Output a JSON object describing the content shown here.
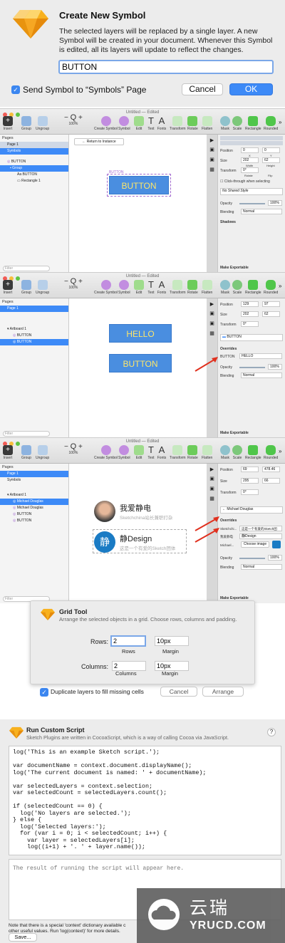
{
  "dialog1": {
    "title": "Create New Symbol",
    "description": "The selected layers will be replaced by a single layer. A new Symbol will be created in your document. Whenever this Symbol is edited, all its layers will update to reflect the changes.",
    "name_value": "BUTTON",
    "checkbox_label": "Send Symbol to “Symbols” Page",
    "cancel": "Cancel",
    "ok": "OK"
  },
  "toolbar": {
    "insert": "Insert",
    "group": "Group",
    "ungroup": "Ungroup",
    "zoom": "100%",
    "create_symbol": "Create Symbol",
    "symbol": "Symbol",
    "edit": "Edit",
    "text": "Text",
    "fonts": "Fonts",
    "transform": "Transform",
    "rotate": "Rotate",
    "flatten": "Flatten",
    "mask": "Mask",
    "scale": "Scale",
    "rectangle": "Rectangle",
    "rounded": "Rounded",
    "minus": "−",
    "plus": "+",
    "more": "»"
  },
  "win1": {
    "title": "Untitled — Edited",
    "pages_header": "Pages",
    "pages": [
      "Page 1",
      "Symbols"
    ],
    "layers": [
      "BUTTON",
      "Group",
      "BUTTON",
      "Rectangle 1"
    ],
    "return_btn": "Return to Instance",
    "artboard_label": "BUTTON",
    "button_text": "BUTTON",
    "position_label": "Position",
    "pos_x": "0",
    "pos_y": "0",
    "x": "X",
    "y": "Y",
    "size_label": "Size",
    "w": "202",
    "h": "62",
    "width": "Width",
    "height": "Height",
    "transform_label": "Transform",
    "rot": "0°",
    "rotate_label": "Rotate",
    "flip_label": "Flip",
    "click_through": "Click-through when selecting",
    "shared_style": "No Shared Style",
    "opacity_label": "Opacity",
    "opacity": "100%",
    "blending_label": "Blending",
    "blending": "Normal",
    "shadows": "Shadows",
    "make_exportable": "Make Exportable",
    "filter": "Filter"
  },
  "win2": {
    "title": "Untitled — Edited",
    "pages_header": "Pages",
    "pages": [
      "Page 1"
    ],
    "layers": [
      "Artboard 1",
      "BUTTON",
      "BUTTON"
    ],
    "hello": "HELLO",
    "button": "BUTTON",
    "pos_x": "129",
    "pos_y": "97",
    "w": "202",
    "h": "62",
    "rot": "0°",
    "symbol": "BUTTON",
    "overrides": "Overrides",
    "override_key": "BUTTON",
    "override_val": "HELLO",
    "opacity": "100%",
    "blending": "Normal",
    "make_exportable": "Make Exportable",
    "filter": "Filter"
  },
  "win3": {
    "title": "Untitled — Edited",
    "pages_header": "Pages",
    "pages": [
      "Page 1",
      "Symbols"
    ],
    "layers": [
      "Artboard 1",
      "Michael Douglas",
      "Michael Douglas",
      "BUTTON",
      "BUTTON"
    ],
    "card1_name": "我爱静电",
    "card1_sub": "Sketchchina站长兼职打杂",
    "card2_name": "静Design",
    "card2_sub": "这是一个有爱的Sketch团体",
    "logo_char": "静",
    "pos_x": "69",
    "pos_y": "478.46",
    "w": "295",
    "h": "66",
    "rot": "0°",
    "symbol": "Michael Douglas",
    "overrides": "Overrides",
    "ov1_key": "Sketchchi...",
    "ov1_val": "这是一个有爱的Sketch团",
    "ov2_key": "我爱静电",
    "ov2_val": "静Design",
    "ov3_key": "Michael...",
    "ov3_val": "Choose image",
    "opacity": "100%",
    "blending": "Normal",
    "make_exportable": "Make Exportable",
    "filter": "Filter"
  },
  "grid_tool": {
    "title": "Grid Tool",
    "subtitle": "Arrange the selected objects in a grid. Choose rows, columns and padding.",
    "rows_label": "Rows:",
    "rows_value": "2",
    "rows_caption": "Rows",
    "rows_margin": "10px",
    "margin_caption": "Margin",
    "cols_label": "Columns:",
    "cols_value": "2",
    "cols_caption": "Columns",
    "cols_margin": "10px",
    "duplicate_label": "Duplicate layers to fill missing cells",
    "cancel": "Cancel",
    "arrange": "Arrange"
  },
  "script": {
    "title": "Run Custom Script",
    "subtitle": "Sketch Plugins are written in CocoaScript, which is a way of calling Cocoa via JavaScript.",
    "help": "?",
    "code": "log('This is an example Sketch script.');\n\nvar documentName = context.document.displayName();\nlog('The current document is named: ' + documentName);\n\nvar selectedLayers = context.selection;\nvar selectedCount = selectedLayers.count();\n\nif (selectedCount == 0) {\n  log('No layers are selected.');\n} else {\n  log('Selected layers:');\n  for (var i = 0; i < selectedCount; i++) {\n    var layer = selectedLayers[i];\n    log((i+1) + '. ' + layer.name());",
    "output_placeholder": "The result of running the script will appear here.",
    "note1": "Note that there is a special 'context' dictionary available c",
    "note2": "other useful values. Run 'log(context)' for more details.",
    "save": "Save..."
  },
  "watermark": {
    "cn": "云瑞",
    "en": "YRUCD.COM"
  },
  "colors": {
    "accent": "#3d8af7",
    "button_fill": "#4a8ee0",
    "button_text": "#fde66a",
    "arrow": "#e0301e"
  }
}
